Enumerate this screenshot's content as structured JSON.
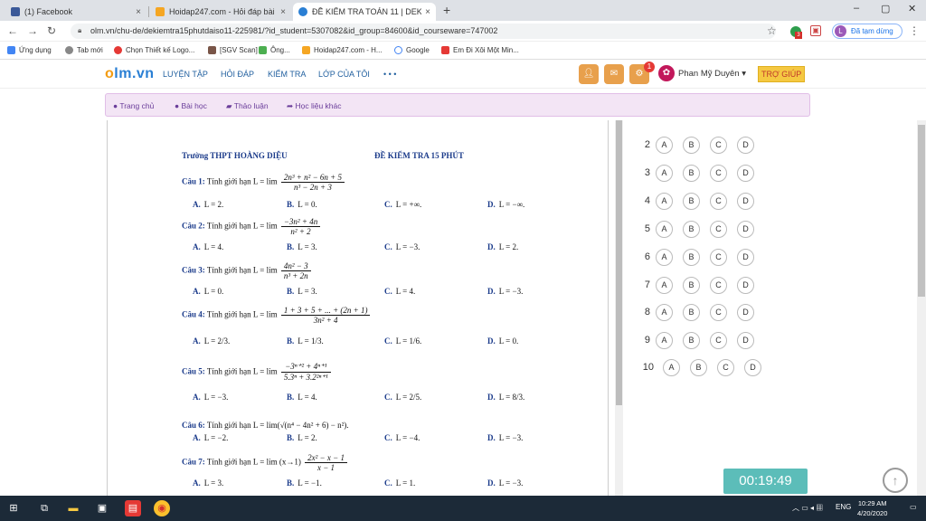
{
  "browser": {
    "tabs": [
      {
        "title": "(1) Facebook",
        "close": "×"
      },
      {
        "title": "Hoidap247.com - Hỏi đáp bài tập",
        "close": "×"
      },
      {
        "title": "ĐỀ KIỂM TRA TOÁN 11 | DEKIEM",
        "close": "×"
      }
    ],
    "new_tab": "+",
    "window_controls": [
      "–",
      "▢",
      "✕"
    ],
    "url": "olm.vn/chu-de/dekiemtra15phutdaiso11-225981/?id_student=5307082&id_group=84600&id_courseware=747002",
    "ext_badge": "3",
    "profile_initial": "L",
    "profile_label": "Đã tạm dừng",
    "bookmarks": [
      "Ứng dụng",
      "Tab mới",
      "Chọn Thiết kế Logo...",
      "[SGV Scan]",
      "Ông...",
      "Hoidap247.com - H...",
      "Google",
      "Em Đi Xôi Một Min..."
    ]
  },
  "site": {
    "logo_o": "o",
    "logo_rest": "lm.vn",
    "menu": [
      "LUYỆN TẬP",
      "HỎI ĐÁP",
      "KIỂM TRA",
      "LỚP CỦA TÔI",
      "• • •"
    ],
    "notif_count": "1",
    "username": "Phan Mỹ Duyên ▾",
    "help": "TRỢ GIÚP",
    "subnav": [
      "Trang chủ",
      "Bài học",
      "Thảo luận",
      "Học liệu khác"
    ]
  },
  "doc": {
    "school": "Trường THPT HOÀNG DIỆU",
    "test_title": "ĐỀ KIỂM TRA 15 PHÚT",
    "questions": [
      {
        "label": "Câu 1:",
        "stem": "Tính giới hạn L = lim",
        "num": "2n³ + n² − 6n + 5",
        "den": "n³ − 2n + 3",
        "opts": [
          "L = 2.",
          "L = 0.",
          "L = +∞.",
          "L = −∞."
        ]
      },
      {
        "label": "Câu 2:",
        "stem": "Tính giới hạn L = lim",
        "num": "−3n² + 4n",
        "den": "n² + 2",
        "opts": [
          "L = 4.",
          "L = 3.",
          "L = −3.",
          "L = 2."
        ]
      },
      {
        "label": "Câu 3:",
        "stem": "Tính giới hạn L = lim",
        "num": "4n² − 3",
        "den": "n³ + 2n",
        "opts": [
          "L = 0.",
          "L = 3.",
          "L = 4.",
          "L = −3."
        ]
      },
      {
        "label": "Câu 4:",
        "stem": "Tính giới hạn L = lim",
        "num": "1 + 3 + 5 + ... + (2n + 1)",
        "den": "3n² + 4",
        "opts": [
          "L = 2/3.",
          "L = 1/3.",
          "L = 1/6.",
          "L = 0."
        ]
      },
      {
        "label": "Câu 5:",
        "stem": "Tính giới hạn L = lim",
        "num": "−3ⁿ⁺² + 4ⁿ⁺¹",
        "den": "5.3ⁿ + 3.2²ⁿ⁺¹",
        "opts": [
          "L = −3.",
          "L = 4.",
          "L = 2/5.",
          "L = 8/3."
        ]
      },
      {
        "label": "Câu 6:",
        "stem": "Tính giới hạn L = lim(√(n⁴ − 4n² + 6) − n²).",
        "num": "",
        "den": "",
        "opts": [
          "L = −2.",
          "L = 2.",
          "L = −4.",
          "L = −3."
        ]
      },
      {
        "label": "Câu 7:",
        "stem": "Tính giới hạn L = lim (x→1)",
        "num": "2x² − x − 1",
        "den": "x − 1",
        "opts": [
          "L = 3.",
          "L = −1.",
          "L = 1.",
          "L = −3."
        ]
      }
    ]
  },
  "answers": {
    "rows": [
      "2",
      "3",
      "4",
      "5",
      "6",
      "7",
      "8",
      "9",
      "10"
    ],
    "choices": [
      "A",
      "B",
      "C",
      "D"
    ]
  },
  "timer": "00:19:49",
  "taskbar": {
    "lang": "ENG",
    "time": "10:29 AM",
    "date": "4/20/2020"
  },
  "colors": {
    "accent": "#2a7fd4",
    "timer": "#5cbdb9",
    "subnav": "#f3e5f5"
  }
}
